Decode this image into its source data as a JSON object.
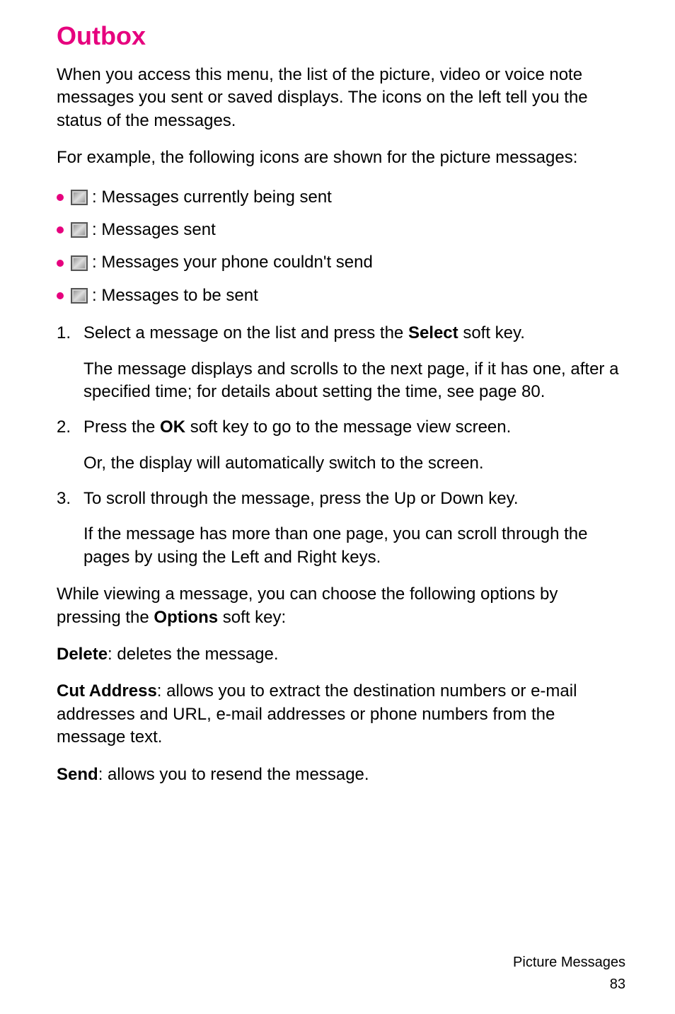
{
  "heading": "Outbox",
  "intro1": "When you access this menu, the list of the picture, video or voice note messages you sent or saved displays. The icons on the left tell you the status of the messages.",
  "intro2": "For example, the following icons are shown for the picture messages:",
  "bullets": {
    "b0": ": Messages currently being sent",
    "b1": ": Messages sent",
    "b2": ": Messages your phone couldn't send",
    "b3": ": Messages to be sent"
  },
  "steps": {
    "s1_a": "Select a message on the list and press the ",
    "s1_b": "Select",
    "s1_c": " soft key.",
    "s1_para": "The message displays and scrolls to the next page, if it has one, after a specified time; for details about setting the time, see page 80.",
    "s2_a": "Press the ",
    "s2_b": "OK",
    "s2_c": " soft key to go to the message view screen.",
    "s2_para": "Or, the display will automatically switch to the screen.",
    "s3": "To scroll through the message, press the Up or Down key.",
    "s3_para": "If the message has more than one page, you can scroll through the pages by using the Left and Right keys."
  },
  "optionsIntro_a": "While viewing a message, you can choose the following options by pressing the ",
  "optionsIntro_b": "Options",
  "optionsIntro_c": " soft key:",
  "delete_label": "Delete",
  "delete_text": ": deletes the message.",
  "cut_label": "Cut Address",
  "cut_text": ": allows you to extract the destination numbers or e-mail addresses and URL, e-mail addresses or phone numbers from the message text.",
  "send_label": "Send",
  "send_text": ": allows you to resend the message.",
  "footer_label": "Picture Messages",
  "footer_page": "83"
}
